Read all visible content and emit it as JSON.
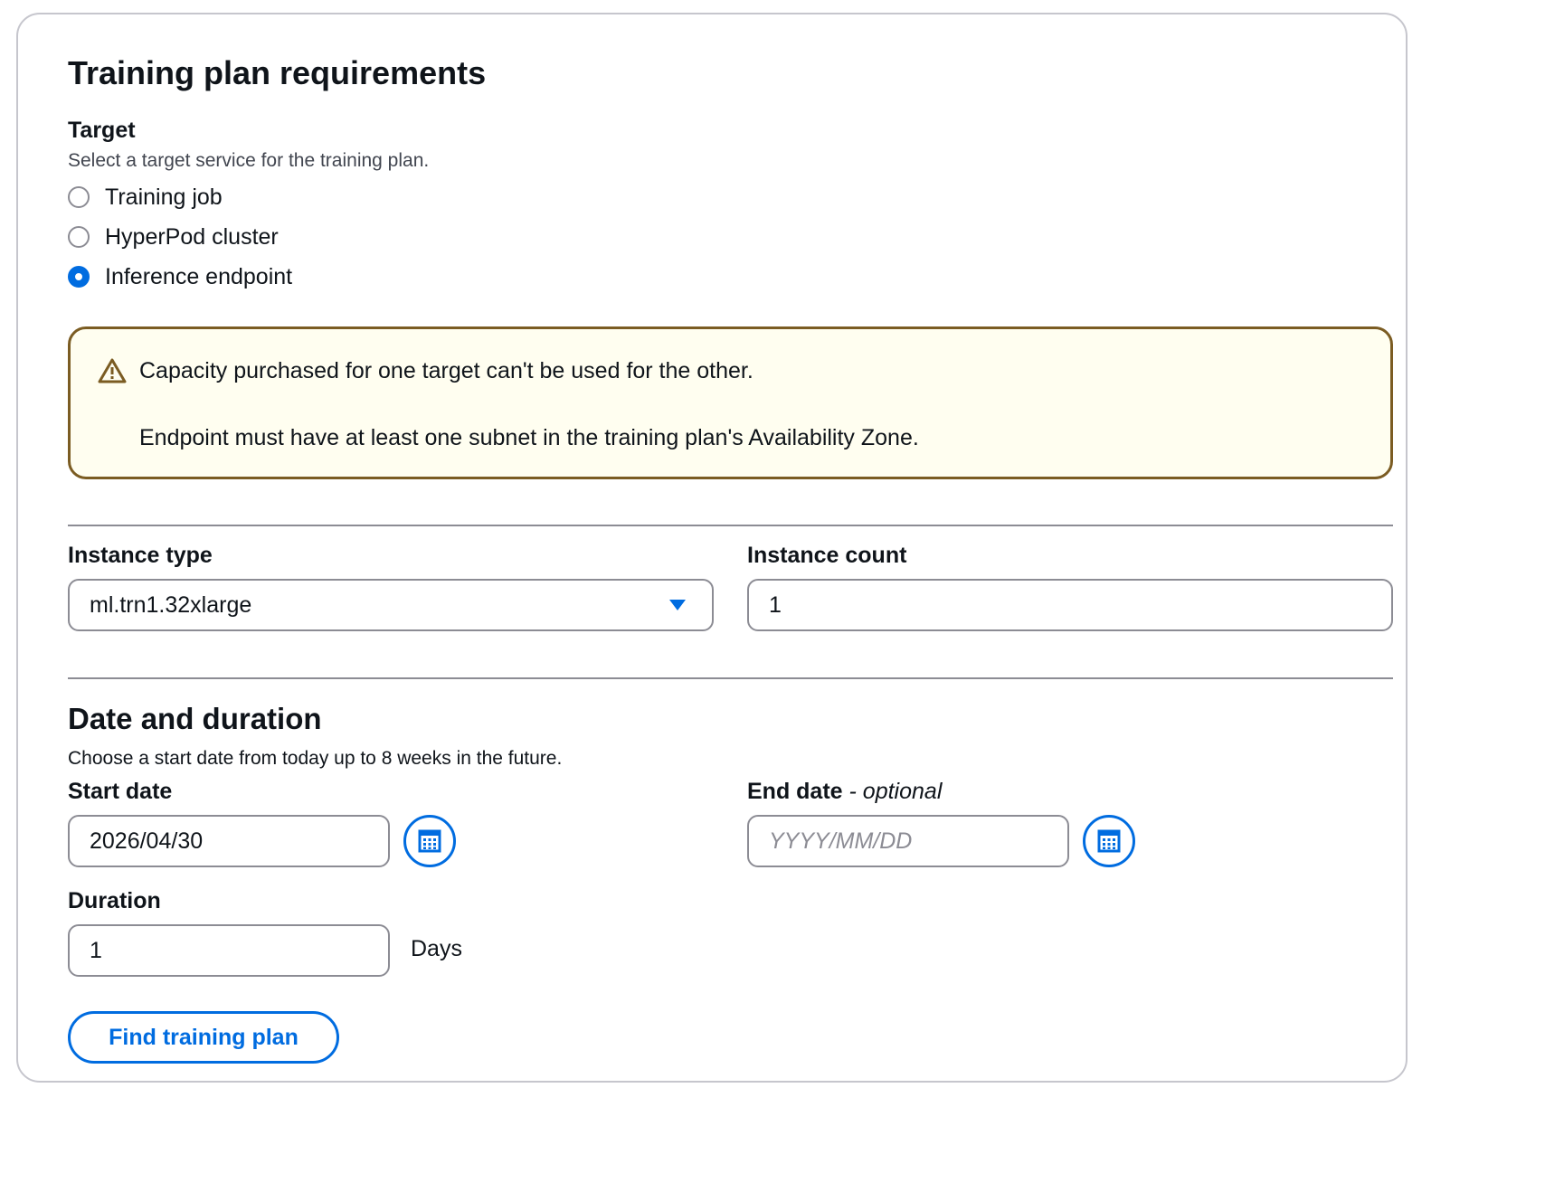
{
  "title": "Training plan requirements",
  "target": {
    "label": "Target",
    "description": "Select a target service for the training plan.",
    "options": [
      {
        "label": "Training job",
        "checked": false
      },
      {
        "label": "HyperPod cluster",
        "checked": false
      },
      {
        "label": "Inference endpoint",
        "checked": true
      }
    ]
  },
  "alert": {
    "icon": "warning-icon",
    "line1": "Capacity purchased for one target can't be used for the other.",
    "line2": "Endpoint must have at least one subnet in the training plan's Availability Zone."
  },
  "instance": {
    "type_label": "Instance type",
    "type_value": "ml.trn1.32xlarge",
    "count_label": "Instance count",
    "count_value": "1"
  },
  "date_duration": {
    "heading": "Date and duration",
    "description": "Choose a start date from today up to 8 weeks in the future.",
    "start_label": "Start date",
    "start_value": "2026/04/30",
    "end_label": "End date",
    "end_optional": "- optional",
    "end_placeholder": "YYYY/MM/DD",
    "duration_label": "Duration",
    "duration_value": "1",
    "duration_unit": "Days"
  },
  "actions": {
    "find_label": "Find training plan"
  },
  "colors": {
    "accent": "#006ce0",
    "alert_border": "#7b5c22",
    "alert_bg": "#fffef0"
  }
}
